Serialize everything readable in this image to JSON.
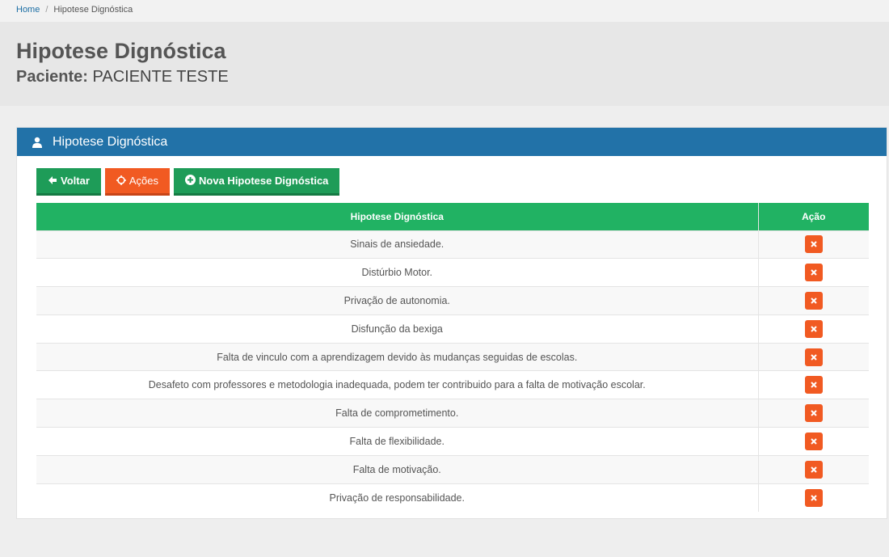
{
  "breadcrumb": {
    "home": "Home",
    "current": "Hipotese Dignóstica"
  },
  "header": {
    "title": "Hipotese Dignóstica",
    "patient_label": "Paciente:",
    "patient_name": "PACIENTE TESTE"
  },
  "panel": {
    "title": "Hipotese Dignóstica",
    "icon": "user-icon",
    "heading_color": "#2272a8"
  },
  "toolbar": {
    "back_label": "Voltar",
    "actions_label": "Ações",
    "new_label": "Nova Hipotese Dignóstica",
    "green": "#1e9c58",
    "orange": "#f15a22"
  },
  "table": {
    "headers": [
      "Hipotese Dignóstica",
      "Ação"
    ],
    "header_color": "#21b263",
    "delete_icon": "close-icon",
    "rows": [
      "Sinais de ansiedade.",
      "Distúrbio Motor.",
      "Privação de autonomia.",
      "Disfunção da bexiga",
      "Falta de vinculo com a aprendizagem devido às mudanças seguidas de escolas.",
      "Desafeto com professores e metodologia inadequada, podem ter contribuido para a falta de motivação escolar.",
      "Falta de comprometimento.",
      "Falta de flexibilidade.",
      "Falta de motivação.",
      "Privação de responsabilidade."
    ]
  }
}
